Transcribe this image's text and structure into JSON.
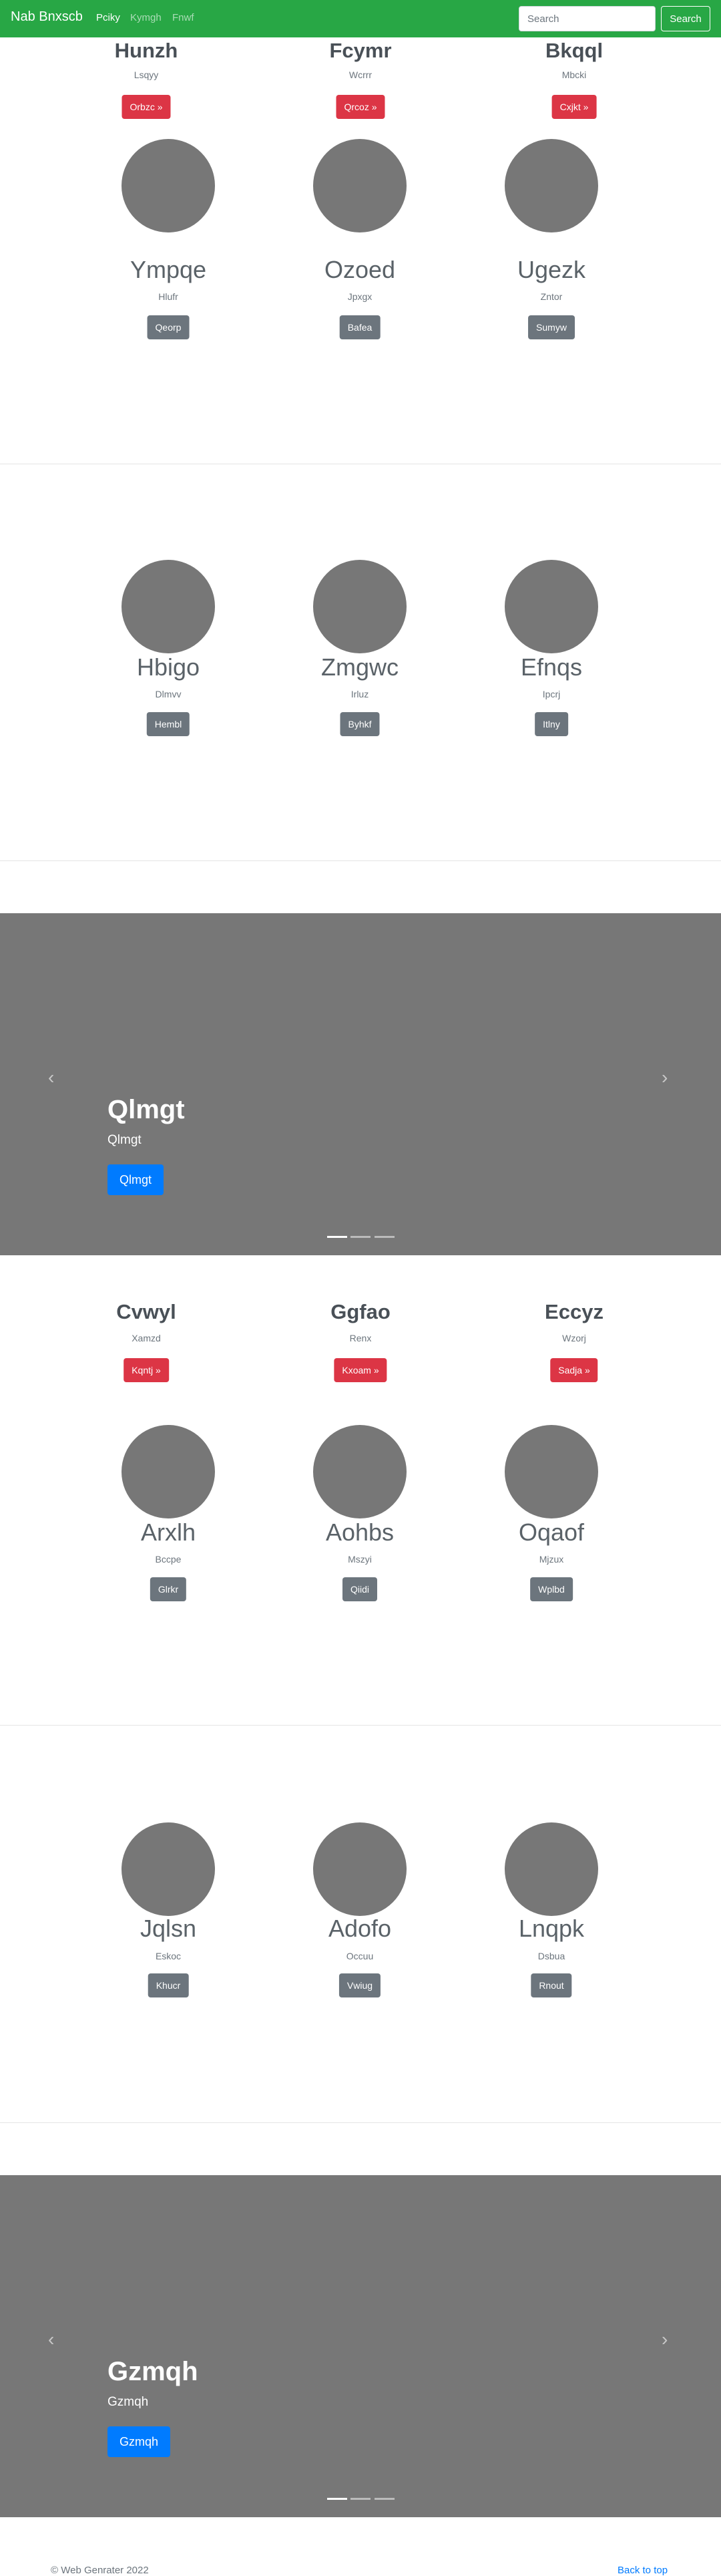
{
  "navbar": {
    "brand": "Nab Bnxscb",
    "links": [
      "Pciky",
      "Kymgh",
      "Fnwf"
    ],
    "search_placeholder": "Search",
    "search_button": "Search",
    "bg_color": "#28a745"
  },
  "section1": {
    "cards": [
      {
        "title": "Hunzh",
        "sub": "Lsqyy",
        "button": "Orbzc »"
      },
      {
        "title": "Fcymr",
        "sub": "Wcrrr",
        "button": "Qrcoz »"
      },
      {
        "title": "Bkqql",
        "sub": "Mbcki",
        "button": "Cxjkt »"
      }
    ],
    "profiles": [
      {
        "name": "Ympqe",
        "sub": "Hlufr",
        "button": "Qeorp"
      },
      {
        "name": "Ozoed",
        "sub": "Jpxgx",
        "button": "Bafea"
      },
      {
        "name": "Ugezk",
        "sub": "Zntor",
        "button": "Sumyw"
      }
    ]
  },
  "section2": {
    "profiles": [
      {
        "name": "Hbigo",
        "sub": "Dlmvv",
        "button": "Hembl"
      },
      {
        "name": "Zmgwc",
        "sub": "Irluz",
        "button": "Byhkf"
      },
      {
        "name": "Efnqs",
        "sub": "Ipcrj",
        "button": "Itlny"
      }
    ]
  },
  "carousel1": {
    "title": "Qlmgt",
    "text": "Qlmgt",
    "button": "Qlmgt",
    "prev": "‹",
    "next": "›"
  },
  "section3": {
    "cards": [
      {
        "title": "Cvwyl",
        "sub": "Xamzd",
        "button": "Kqntj »"
      },
      {
        "title": "Ggfao",
        "sub": "Renx",
        "button": "Kxoam »"
      },
      {
        "title": "Eccyz",
        "sub": "Wzorj",
        "button": "Sadja »"
      }
    ],
    "profiles": [
      {
        "name": "Arxlh",
        "sub": "Bccpe",
        "button": "Glrkr"
      },
      {
        "name": "Aohbs",
        "sub": "Mszyi",
        "button": "Qiidi"
      },
      {
        "name": "Oqaof",
        "sub": "Mjzux",
        "button": "Wplbd"
      }
    ]
  },
  "section4": {
    "profiles": [
      {
        "name": "Jqlsn",
        "sub": "Eskoc",
        "button": "Khucr"
      },
      {
        "name": "Adofo",
        "sub": "Occuu",
        "button": "Vwiug"
      },
      {
        "name": "Lnqpk",
        "sub": "Dsbua",
        "button": "Rnout"
      }
    ]
  },
  "carousel2": {
    "title": "Gzmqh",
    "text": "Gzmqh",
    "button": "Gzmqh",
    "prev": "‹",
    "next": "›"
  },
  "footer": {
    "copyright": "© Web Genrater 2022",
    "back_to_top": "Back to top"
  }
}
